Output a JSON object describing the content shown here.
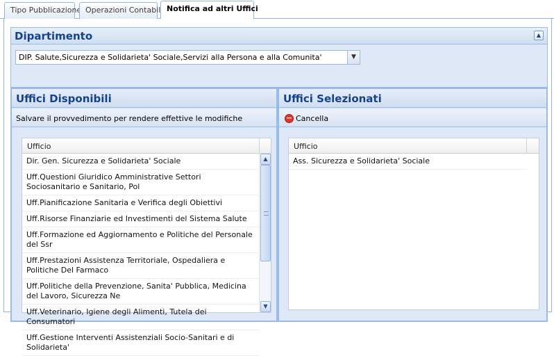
{
  "tabs": [
    {
      "label": "Tipo Pubblicazione",
      "active": false
    },
    {
      "label": "Operazioni Contabili",
      "active": false
    },
    {
      "label": "Notifica ad altri Uffici",
      "active": true
    }
  ],
  "department": {
    "title": "Dipartimento",
    "selected": "DIP. Salute,Sicurezza e Solidarieta' Sociale,Servizi alla Persona e alla Comunita'"
  },
  "available": {
    "title": "Uffici Disponibili",
    "note": "Salvare il provvedimento per rendere effettive le modifiche",
    "column": "Ufficio",
    "rows": [
      "Dir. Gen. Sicurezza e Solidarieta' Sociale",
      "Uff.Questioni Giuridico Amministrative Settori Sociosanitario e Sanitario, Pol",
      "Uff.Pianificazione Sanitaria e Verifica degli Obiettivi",
      "Uff.Risorse Finanziarie ed Investimenti del Sistema Salute",
      "Uff.Formazione ed Aggiornamento e Politiche del Personale del Ssr",
      "Uff.Prestazioni Assistenza Territoriale, Ospedaliera e Politiche Del Farmaco",
      "Uff.Politiche della Prevenzione, Sanita' Pubblica, Medicina del Lavoro, Sicurezza Ne",
      "Uff.Veterinario, Igiene degli Alimenti, Tutela dei Consumatori",
      "Uff.Gestione Interventi Assistenziali Socio-Sanitari e di Solidarieta'"
    ]
  },
  "selected": {
    "title": "Uffici Selezionati",
    "cancel_label": "Cancella",
    "column": "Ufficio",
    "rows": [
      "Ass. Sicurezza e Solidarieta' Sociale"
    ]
  }
}
